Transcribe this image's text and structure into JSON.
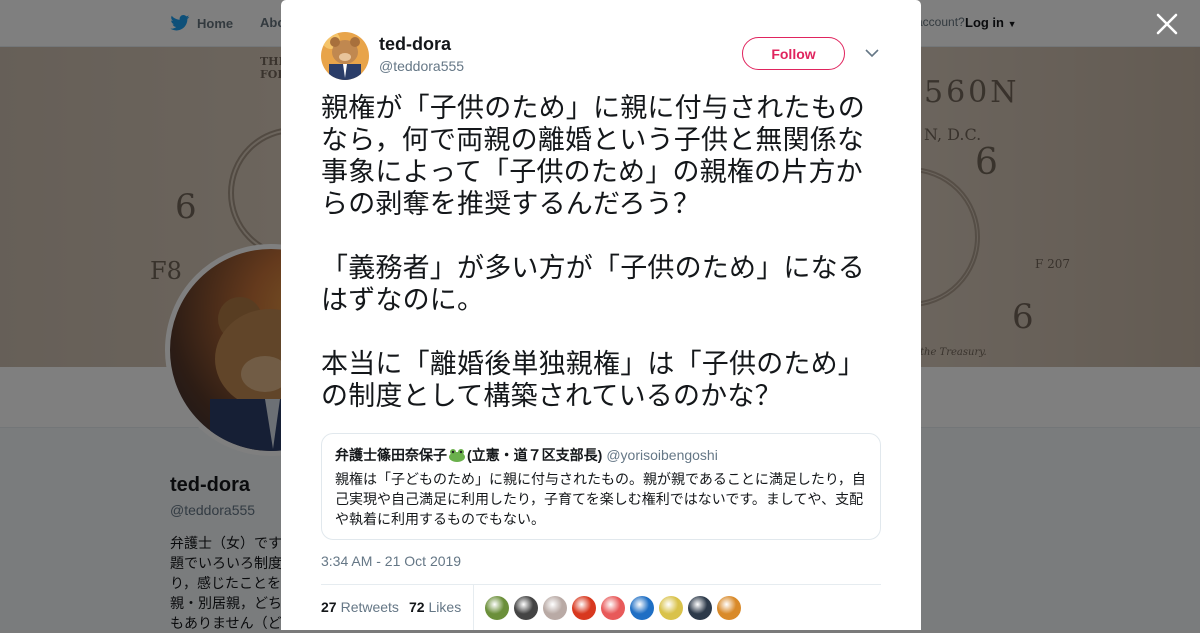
{
  "background": {
    "nav": {
      "home_label": "Home",
      "about_label": "Abo",
      "account_text": "account?",
      "login_label": "Log in"
    },
    "banner_text": {
      "t1": "THI\nFOR ALL",
      "t2": "6",
      "t3": "F8",
      "t4": "560N",
      "t5": "N, D.C.",
      "t6": "6",
      "t7": "6",
      "t8": "F 207",
      "t9": "the Treasury."
    },
    "profile": {
      "name": "ted-dora",
      "handle": "@teddora555",
      "bio": "弁護士（女）です\n題でいろいろ制度\nり，感じたことを\n親・別居親，どち\nもありません（ど"
    }
  },
  "tweet": {
    "author_name": "ted-dora",
    "author_handle": "@teddora555",
    "follow_label": "Follow",
    "paragraphs": [
      "親権が「子供のため」に親に付与されたものなら，何で両親の離婚という子供と無関係な事象によって「子供のため」の親権の片方からの剥奪を推奨するんだろう？",
      "「義務者」が多い方が「子供のため」になるはずなのに。",
      "本当に「離婚後単独親権」は「子供のため」の制度として構築されているのかな？"
    ],
    "quoted": {
      "name_before": "弁護士篠田奈保子",
      "name_after": "(立憲・道７区支部長)",
      "handle": "@yorisoibengoshi",
      "text": "親権は「子どものため」に親に付与されたもの。親が親であることに満足したり，自己実現や自己満足に利用したり，子育てを楽しむ権利ではないです。ましてや、支配や執着に利用するものでもない。"
    },
    "timestamp": "3:34 AM - 21 Oct 2019",
    "retweets_count": "27",
    "retweets_label": "Retweets",
    "likes_count": "72",
    "likes_label": "Likes",
    "liker_colors": [
      "#6b8f3a",
      "#444444",
      "#b9aaa5",
      "#d8381f",
      "#e85a5a",
      "#1f6fc4",
      "#d9c24a",
      "#2d3a4a",
      "#d98a2a"
    ]
  },
  "colors": {
    "accent": "#e0245e",
    "text": "#14171a",
    "muted": "#657786",
    "twitter_blue": "#1da1f2"
  }
}
